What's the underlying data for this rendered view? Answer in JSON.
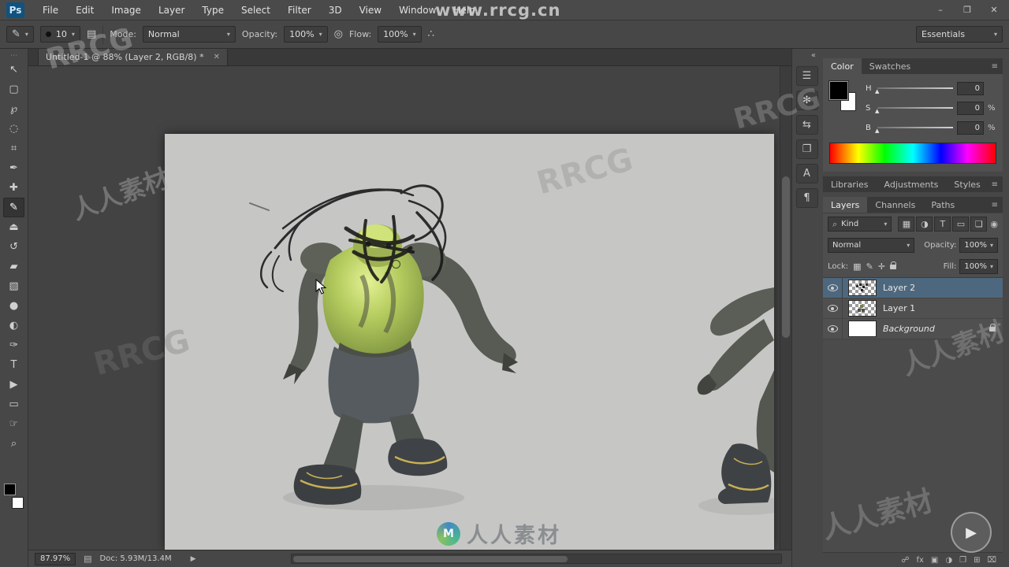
{
  "menubar": {
    "logo": "Ps",
    "items": [
      {
        "label": "File"
      },
      {
        "label": "Edit"
      },
      {
        "label": "Image"
      },
      {
        "label": "Layer"
      },
      {
        "label": "Type"
      },
      {
        "label": "Select"
      },
      {
        "label": "Filter"
      },
      {
        "label": "3D"
      },
      {
        "label": "View"
      },
      {
        "label": "Window"
      },
      {
        "label": "Help"
      }
    ],
    "window_controls": {
      "minimize": "–",
      "maximize": "❐",
      "close": "✕"
    }
  },
  "options_bar": {
    "tool_icon": "✎",
    "brush_size": "10",
    "panel_toggle_icon": "▤",
    "mode_label": "Mode:",
    "mode_value": "Normal",
    "opacity_label": "Opacity:",
    "opacity_value": "100%",
    "pressure_icon": "◎",
    "flow_label": "Flow:",
    "flow_value": "100%",
    "airbrush_icon": "∴",
    "workspace": "Essentials"
  },
  "document_tab": {
    "title": "Untitled-1 @ 88% (Layer 2, RGB/8) *",
    "close": "✕"
  },
  "tools": [
    {
      "name": "move",
      "glyph": "↖"
    },
    {
      "name": "rectangular-marquee",
      "glyph": "▢"
    },
    {
      "name": "lasso",
      "glyph": "℘"
    },
    {
      "name": "quick-selection",
      "glyph": "◌"
    },
    {
      "name": "crop",
      "glyph": "⌗"
    },
    {
      "name": "eyedropper",
      "glyph": "✒"
    },
    {
      "name": "healing-brush",
      "glyph": "✚"
    },
    {
      "name": "brush",
      "glyph": "✎"
    },
    {
      "name": "clone-stamp",
      "glyph": "⏏"
    },
    {
      "name": "history-brush",
      "glyph": "↺"
    },
    {
      "name": "eraser",
      "glyph": "▰"
    },
    {
      "name": "gradient",
      "glyph": "▧"
    },
    {
      "name": "blur",
      "glyph": "●"
    },
    {
      "name": "dodge",
      "glyph": "◐"
    },
    {
      "name": "pen",
      "glyph": "✑"
    },
    {
      "name": "type",
      "glyph": "T"
    },
    {
      "name": "path-selection",
      "glyph": "▶"
    },
    {
      "name": "rectangle",
      "glyph": "▭"
    },
    {
      "name": "hand",
      "glyph": "☞"
    },
    {
      "name": "zoom",
      "glyph": "⌕"
    }
  ],
  "strip_icons": [
    {
      "name": "brush-settings",
      "glyph": "☰"
    },
    {
      "name": "adjustments",
      "glyph": "✻"
    },
    {
      "name": "clone-source",
      "glyph": "⇆"
    },
    {
      "name": "info",
      "glyph": "❐"
    },
    {
      "name": "character",
      "glyph": "A"
    },
    {
      "name": "paragraph",
      "glyph": "¶"
    }
  ],
  "color_panel": {
    "tabs": [
      {
        "label": "Color"
      },
      {
        "label": "Swatches"
      }
    ],
    "sliders": [
      {
        "label": "H",
        "value": "0",
        "unit": ""
      },
      {
        "label": "S",
        "value": "0",
        "unit": "%"
      },
      {
        "label": "B",
        "value": "0",
        "unit": "%"
      }
    ]
  },
  "mid_tabs": [
    {
      "label": "Libraries"
    },
    {
      "label": "Adjustments"
    },
    {
      "label": "Styles"
    }
  ],
  "layers_panel": {
    "tabs": [
      {
        "label": "Layers"
      },
      {
        "label": "Channels"
      },
      {
        "label": "Paths"
      }
    ],
    "kind_label": "Kind",
    "filter_icons": [
      {
        "name": "pixel-layers",
        "glyph": "▦"
      },
      {
        "name": "adjustment-layers",
        "glyph": "◑"
      },
      {
        "name": "type-layers",
        "glyph": "T"
      },
      {
        "name": "shape-layers",
        "glyph": "▭"
      },
      {
        "name": "smart-objects",
        "glyph": "❏"
      }
    ],
    "filter_toggle_icon": "◉",
    "blend_mode": "Normal",
    "opacity_label": "Opacity:",
    "opacity_value": "100%",
    "lock_label": "Lock:",
    "lock_icons": [
      {
        "name": "lock-transparency",
        "glyph": "▦"
      },
      {
        "name": "lock-pixels",
        "glyph": "✎"
      },
      {
        "name": "lock-position",
        "glyph": "✛"
      }
    ],
    "fill_label": "Fill:",
    "fill_value": "100%",
    "layers": [
      {
        "name": "Layer 2"
      },
      {
        "name": "Layer 1"
      },
      {
        "name": "Background"
      }
    ],
    "footer_icons": [
      {
        "name": "link-layers",
        "glyph": "☍"
      },
      {
        "name": "layer-effects",
        "glyph": "fx"
      },
      {
        "name": "add-mask",
        "glyph": "▣"
      },
      {
        "name": "adjustment-layer",
        "glyph": "◑"
      },
      {
        "name": "new-group",
        "glyph": "❐"
      },
      {
        "name": "new-layer",
        "glyph": "⊞"
      },
      {
        "name": "delete-layer",
        "glyph": "⌧"
      }
    ]
  },
  "status_bar": {
    "zoom": "87.97%",
    "doc_icon": "▤",
    "doc_info": "Doc: 5.93M/13.4M"
  },
  "watermarks": {
    "url": "www.rrcg.cn",
    "rrcg": "RRCG",
    "renren": "人人素材",
    "logo_letter": "M"
  },
  "ui": {
    "caret": "▾",
    "search": "⌕",
    "collapse": "«",
    "slider_thumb": "▲",
    "status_arrow": "▶",
    "panel_menu": "≡",
    "grip": "⋯",
    "play": "▶"
  }
}
